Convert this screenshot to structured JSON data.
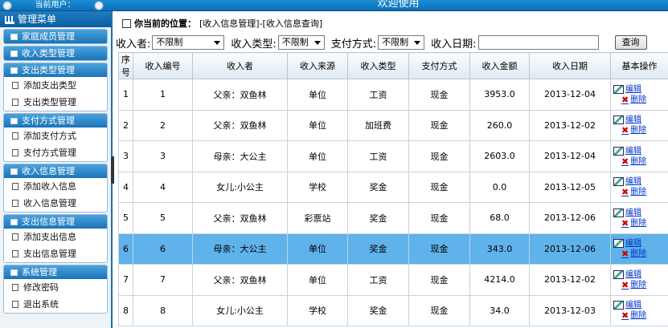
{
  "header": {
    "user_label": "当前用户：",
    "title": "欢迎使用"
  },
  "sidebar": {
    "menu_title": "管理菜单",
    "groups": [
      {
        "label": "家庭成员管理",
        "items": []
      },
      {
        "label": "收入类型管理",
        "items": []
      },
      {
        "label": "支出类型管理",
        "items": [
          {
            "label": "添加支出类型"
          },
          {
            "label": "支出类型管理"
          }
        ]
      },
      {
        "label": "支付方式管理",
        "items": [
          {
            "label": "添加支付方式"
          },
          {
            "label": "支付方式管理"
          }
        ]
      },
      {
        "label": "收入信息管理",
        "items": [
          {
            "label": "添加收入信息"
          },
          {
            "label": "收入信息管理"
          }
        ]
      },
      {
        "label": "支出信息管理",
        "items": [
          {
            "label": "添加支出信息"
          },
          {
            "label": "支出信息管理"
          }
        ]
      },
      {
        "label": "系统管理",
        "items": [
          {
            "label": "修改密码"
          },
          {
            "label": "退出系统"
          }
        ]
      }
    ]
  },
  "main": {
    "crumb_label": "你当前的位置：",
    "crumb_path": "[收入信息管理]-[收入信息查询]",
    "filters": {
      "receiver_label": "收入者:",
      "receiver_value": "不限制",
      "type_label": "收入类型:",
      "type_value": "不限制",
      "pay_label": "支付方式:",
      "pay_value": "不限制",
      "date_label": "收入日期:",
      "date_value": "",
      "query_button": "查询"
    },
    "columns": [
      "序号",
      "收入编号",
      "收入者",
      "收入来源",
      "收入类型",
      "支付方式",
      "收入金额",
      "收入日期",
      "基本操作"
    ],
    "rows": [
      {
        "seq": "1",
        "id": "1",
        "receiver": "父亲：双鱼林",
        "source": "单位",
        "type": "工资",
        "pay": "现金",
        "amount": "3953.0",
        "date": "2013-12-04"
      },
      {
        "seq": "2",
        "id": "2",
        "receiver": "父亲：双鱼林",
        "source": "单位",
        "type": "加班费",
        "pay": "现金",
        "amount": "260.0",
        "date": "2013-12-02"
      },
      {
        "seq": "3",
        "id": "3",
        "receiver": "母亲：大公主",
        "source": "单位",
        "type": "工资",
        "pay": "现金",
        "amount": "2603.0",
        "date": "2013-12-04"
      },
      {
        "seq": "4",
        "id": "4",
        "receiver": "女儿:小公主",
        "source": "学校",
        "type": "奖金",
        "pay": "现金",
        "amount": "0.0",
        "date": "2013-12-05"
      },
      {
        "seq": "5",
        "id": "5",
        "receiver": "父亲：双鱼林",
        "source": "彩票站",
        "type": "奖金",
        "pay": "现金",
        "amount": "68.0",
        "date": "2013-12-06"
      },
      {
        "seq": "6",
        "id": "6",
        "receiver": "母亲：大公主",
        "source": "单位",
        "type": "奖金",
        "pay": "现金",
        "amount": "343.0",
        "date": "2013-12-06"
      },
      {
        "seq": "7",
        "id": "7",
        "receiver": "父亲：双鱼林",
        "source": "单位",
        "type": "工资",
        "pay": "现金",
        "amount": "4214.0",
        "date": "2013-12-02"
      },
      {
        "seq": "8",
        "id": "8",
        "receiver": "女儿:小公主",
        "source": "学校",
        "type": "奖金",
        "pay": "现金",
        "amount": "34.0",
        "date": "2013-12-03"
      }
    ],
    "selected_row": "6",
    "edit_label": "编辑",
    "delete_label": "删除"
  }
}
